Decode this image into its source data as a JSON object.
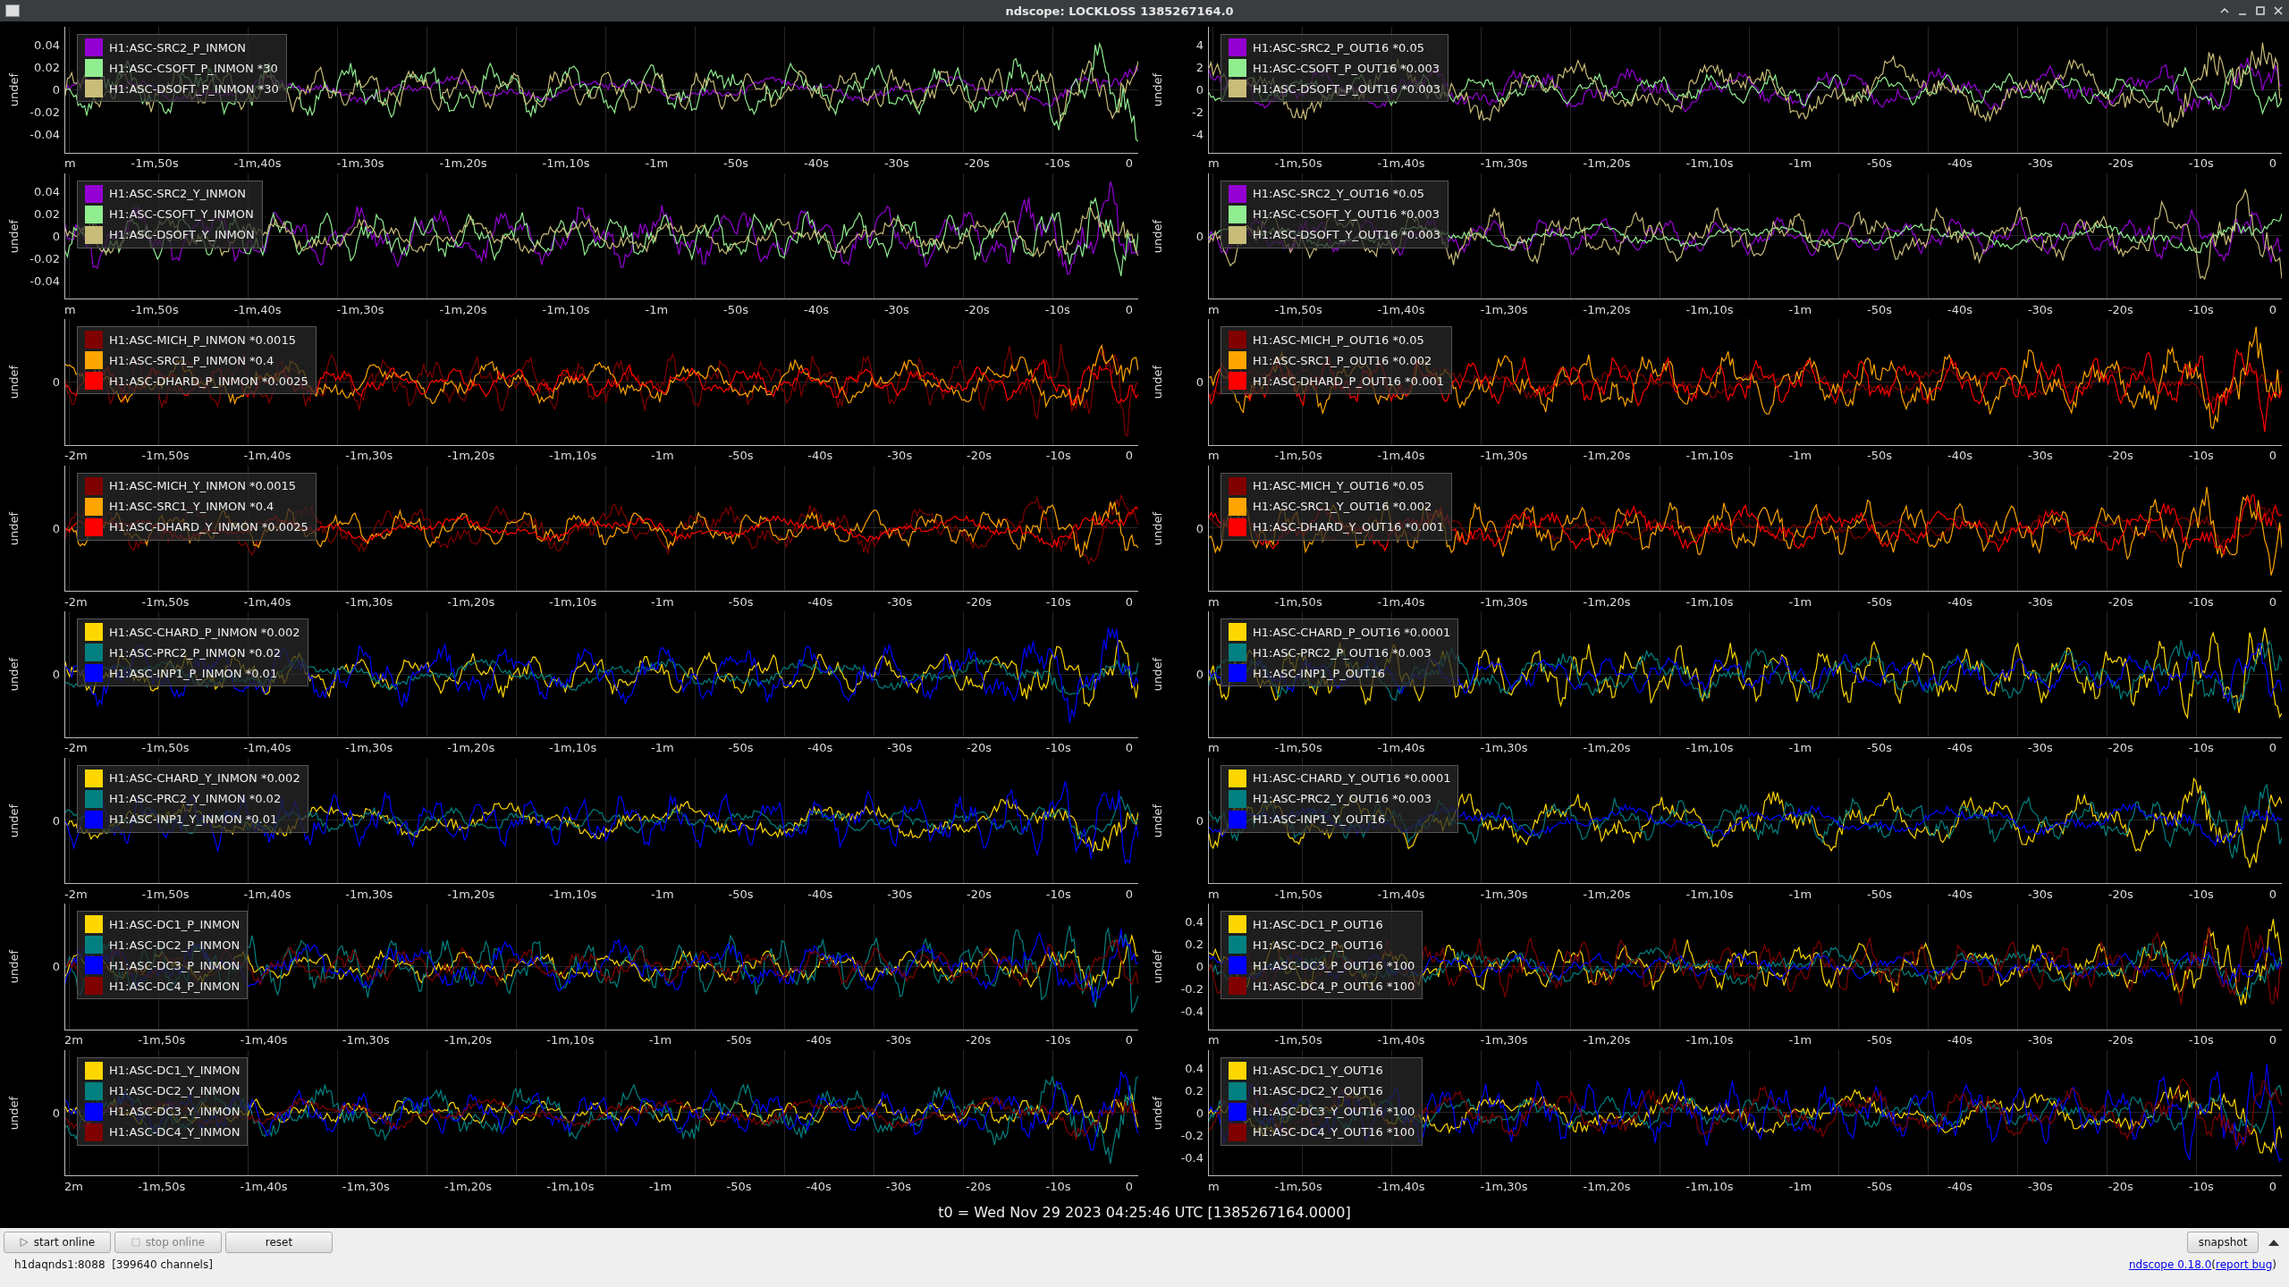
{
  "window": {
    "title": "ndscope: LOCKLOSS 1385267164.0"
  },
  "plots": [
    {
      "ylabel": "undef",
      "yticks": [
        "0.04",
        "0.02",
        "0",
        "-0.02",
        "-0.04"
      ],
      "xticks": [
        "m",
        "-1m,50s",
        "-1m,40s",
        "-1m,30s",
        "-1m,20s",
        "-1m,10s",
        "-1m",
        "-50s",
        "-40s",
        "-30s",
        "-20s",
        "-10s",
        "0"
      ],
      "channels": [
        {
          "name": "H1:ASC-SRC2_P_INMON",
          "color": "#9400d3"
        },
        {
          "name": "H1:ASC-CSOFT_P_INMON *30",
          "color": "#90ee90"
        },
        {
          "name": "H1:ASC-DSOFT_P_INMON *30",
          "color": "#c8bc78"
        }
      ]
    },
    {
      "ylabel": "undef",
      "yticks": [
        "4",
        "2",
        "0",
        "-2",
        "-4"
      ],
      "xticks": [
        "m",
        "-1m,50s",
        "-1m,40s",
        "-1m,30s",
        "-1m,20s",
        "-1m,10s",
        "-1m",
        "-50s",
        "-40s",
        "-30s",
        "-20s",
        "-10s",
        "0"
      ],
      "channels": [
        {
          "name": "H1:ASC-SRC2_P_OUT16 *0.05",
          "color": "#9400d3"
        },
        {
          "name": "H1:ASC-CSOFT_P_OUT16 *0.003",
          "color": "#90ee90"
        },
        {
          "name": "H1:ASC-DSOFT_P_OUT16 *0.003",
          "color": "#c8bc78"
        }
      ]
    },
    {
      "ylabel": "undef",
      "yticks": [
        "0.04",
        "0.02",
        "0",
        "-0.02",
        "-0.04"
      ],
      "xticks": [
        "m",
        "-1m,50s",
        "-1m,40s",
        "-1m,30s",
        "-1m,20s",
        "-1m,10s",
        "-1m",
        "-50s",
        "-40s",
        "-30s",
        "-20s",
        "-10s",
        "0"
      ],
      "channels": [
        {
          "name": "H1:ASC-SRC2_Y_INMON",
          "color": "#9400d3"
        },
        {
          "name": "H1:ASC-CSOFT_Y_INMON",
          "color": "#90ee90"
        },
        {
          "name": "H1:ASC-DSOFT_Y_INMON",
          "color": "#c8bc78"
        }
      ]
    },
    {
      "ylabel": "undef",
      "yticks": [
        "0"
      ],
      "xticks": [
        "m",
        "-1m,50s",
        "-1m,40s",
        "-1m,30s",
        "-1m,20s",
        "-1m,10s",
        "-1m",
        "-50s",
        "-40s",
        "-30s",
        "-20s",
        "-10s",
        "0"
      ],
      "channels": [
        {
          "name": "H1:ASC-SRC2_Y_OUT16 *0.05",
          "color": "#9400d3"
        },
        {
          "name": "H1:ASC-CSOFT_Y_OUT16 *0.003",
          "color": "#90ee90"
        },
        {
          "name": "H1:ASC-DSOFT_Y_OUT16 *0.003",
          "color": "#c8bc78"
        }
      ]
    },
    {
      "ylabel": "undef",
      "yticks": [
        "0"
      ],
      "xticks": [
        "-2m",
        "-1m,50s",
        "-1m,40s",
        "-1m,30s",
        "-1m,20s",
        "-1m,10s",
        "-1m",
        "-50s",
        "-40s",
        "-30s",
        "-20s",
        "-10s",
        "0"
      ],
      "channels": [
        {
          "name": "H1:ASC-MICH_P_INMON *0.0015",
          "color": "#800000"
        },
        {
          "name": "H1:ASC-SRC1_P_INMON *0.4",
          "color": "#ffa500"
        },
        {
          "name": "H1:ASC-DHARD_P_INMON *0.0025",
          "color": "#ff0000"
        }
      ]
    },
    {
      "ylabel": "undef",
      "yticks": [
        "0"
      ],
      "xticks": [
        "m",
        "-1m,50s",
        "-1m,40s",
        "-1m,30s",
        "-1m,20s",
        "-1m,10s",
        "-1m",
        "-50s",
        "-40s",
        "-30s",
        "-20s",
        "-10s",
        "0"
      ],
      "channels": [
        {
          "name": "H1:ASC-MICH_P_OUT16 *0.05",
          "color": "#800000"
        },
        {
          "name": "H1:ASC-SRC1_P_OUT16 *0.002",
          "color": "#ffa500"
        },
        {
          "name": "H1:ASC-DHARD_P_OUT16 *0.001",
          "color": "#ff0000"
        }
      ]
    },
    {
      "ylabel": "undef",
      "yticks": [
        "0"
      ],
      "xticks": [
        "-2m",
        "-1m,50s",
        "-1m,40s",
        "-1m,30s",
        "-1m,20s",
        "-1m,10s",
        "-1m",
        "-50s",
        "-40s",
        "-30s",
        "-20s",
        "-10s",
        "0"
      ],
      "channels": [
        {
          "name": "H1:ASC-MICH_Y_INMON *0.0015",
          "color": "#800000"
        },
        {
          "name": "H1:ASC-SRC1_Y_INMON *0.4",
          "color": "#ffa500"
        },
        {
          "name": "H1:ASC-DHARD_Y_INMON *0.0025",
          "color": "#ff0000"
        }
      ]
    },
    {
      "ylabel": "undef",
      "yticks": [
        "0"
      ],
      "xticks": [
        "m",
        "-1m,50s",
        "-1m,40s",
        "-1m,30s",
        "-1m,20s",
        "-1m,10s",
        "-1m",
        "-50s",
        "-40s",
        "-30s",
        "-20s",
        "-10s",
        "0"
      ],
      "channels": [
        {
          "name": "H1:ASC-MICH_Y_OUT16 *0.05",
          "color": "#800000"
        },
        {
          "name": "H1:ASC-SRC1_Y_OUT16 *0.002",
          "color": "#ffa500"
        },
        {
          "name": "H1:ASC-DHARD_Y_OUT16 *0.001",
          "color": "#ff0000"
        }
      ]
    },
    {
      "ylabel": "undef",
      "yticks": [
        "0"
      ],
      "xticks": [
        "-2m",
        "-1m,50s",
        "-1m,40s",
        "-1m,30s",
        "-1m,20s",
        "-1m,10s",
        "-1m",
        "-50s",
        "-40s",
        "-30s",
        "-20s",
        "-10s",
        "0"
      ],
      "channels": [
        {
          "name": "H1:ASC-CHARD_P_INMON *0.002",
          "color": "#ffd700"
        },
        {
          "name": "H1:ASC-PRC2_P_INMON *0.02",
          "color": "#008080"
        },
        {
          "name": "H1:ASC-INP1_P_INMON *0.01",
          "color": "#0000ff"
        }
      ]
    },
    {
      "ylabel": "undef",
      "yticks": [
        "0"
      ],
      "xticks": [
        "m",
        "-1m,50s",
        "-1m,40s",
        "-1m,30s",
        "-1m,20s",
        "-1m,10s",
        "-1m",
        "-50s",
        "-40s",
        "-30s",
        "-20s",
        "-10s",
        "0"
      ],
      "channels": [
        {
          "name": "H1:ASC-CHARD_P_OUT16 *0.0001",
          "color": "#ffd700"
        },
        {
          "name": "H1:ASC-PRC2_P_OUT16 *0.003",
          "color": "#008080"
        },
        {
          "name": "H1:ASC-INP1_P_OUT16",
          "color": "#0000ff"
        }
      ]
    },
    {
      "ylabel": "undef",
      "yticks": [
        "0"
      ],
      "xticks": [
        "-2m",
        "-1m,50s",
        "-1m,40s",
        "-1m,30s",
        "-1m,20s",
        "-1m,10s",
        "-1m",
        "-50s",
        "-40s",
        "-30s",
        "-20s",
        "-10s",
        "0"
      ],
      "channels": [
        {
          "name": "H1:ASC-CHARD_Y_INMON *0.002",
          "color": "#ffd700"
        },
        {
          "name": "H1:ASC-PRC2_Y_INMON *0.02",
          "color": "#008080"
        },
        {
          "name": "H1:ASC-INP1_Y_INMON *0.01",
          "color": "#0000ff"
        }
      ]
    },
    {
      "ylabel": "undef",
      "yticks": [
        "0"
      ],
      "xticks": [
        "m",
        "-1m,50s",
        "-1m,40s",
        "-1m,30s",
        "-1m,20s",
        "-1m,10s",
        "-1m",
        "-50s",
        "-40s",
        "-30s",
        "-20s",
        "-10s",
        "0"
      ],
      "channels": [
        {
          "name": "H1:ASC-CHARD_Y_OUT16 *0.0001",
          "color": "#ffd700"
        },
        {
          "name": "H1:ASC-PRC2_Y_OUT16 *0.003",
          "color": "#008080"
        },
        {
          "name": "H1:ASC-INP1_Y_OUT16",
          "color": "#0000ff"
        }
      ]
    },
    {
      "ylabel": "undef",
      "yticks": [
        "0"
      ],
      "xticks": [
        "2m",
        "-1m,50s",
        "-1m,40s",
        "-1m,30s",
        "-1m,20s",
        "-1m,10s",
        "-1m",
        "-50s",
        "-40s",
        "-30s",
        "-20s",
        "-10s",
        "0"
      ],
      "channels": [
        {
          "name": "H1:ASC-DC1_P_INMON",
          "color": "#ffd700"
        },
        {
          "name": "H1:ASC-DC2_P_INMON",
          "color": "#008080"
        },
        {
          "name": "H1:ASC-DC3_P_INMON",
          "color": "#0000ff"
        },
        {
          "name": "H1:ASC-DC4_P_INMON",
          "color": "#800000"
        }
      ]
    },
    {
      "ylabel": "undef",
      "yticks": [
        "0.4",
        "0.2",
        "0",
        "-0.2",
        "-0.4"
      ],
      "xticks": [
        "m",
        "-1m,50s",
        "-1m,40s",
        "-1m,30s",
        "-1m,20s",
        "-1m,10s",
        "-1m",
        "-50s",
        "-40s",
        "-30s",
        "-20s",
        "-10s",
        "0"
      ],
      "channels": [
        {
          "name": "H1:ASC-DC1_P_OUT16",
          "color": "#ffd700"
        },
        {
          "name": "H1:ASC-DC2_P_OUT16",
          "color": "#008080"
        },
        {
          "name": "H1:ASC-DC3_P_OUT16 *100",
          "color": "#0000ff"
        },
        {
          "name": "H1:ASC-DC4_P_OUT16 *100",
          "color": "#800000"
        }
      ]
    },
    {
      "ylabel": "undef",
      "yticks": [
        "0"
      ],
      "xticks": [
        "2m",
        "-1m,50s",
        "-1m,40s",
        "-1m,30s",
        "-1m,20s",
        "-1m,10s",
        "-1m",
        "-50s",
        "-40s",
        "-30s",
        "-20s",
        "-10s",
        "0"
      ],
      "channels": [
        {
          "name": "H1:ASC-DC1_Y_INMON",
          "color": "#ffd700"
        },
        {
          "name": "H1:ASC-DC2_Y_INMON",
          "color": "#008080"
        },
        {
          "name": "H1:ASC-DC3_Y_INMON",
          "color": "#0000ff"
        },
        {
          "name": "H1:ASC-DC4_Y_INMON",
          "color": "#800000"
        }
      ]
    },
    {
      "ylabel": "undef",
      "yticks": [
        "0.4",
        "0.2",
        "0",
        "-0.2",
        "-0.4"
      ],
      "xticks": [
        "m",
        "-1m,50s",
        "-1m,40s",
        "-1m,30s",
        "-1m,20s",
        "-1m,10s",
        "-1m",
        "-50s",
        "-40s",
        "-30s",
        "-20s",
        "-10s",
        "0"
      ],
      "channels": [
        {
          "name": "H1:ASC-DC1_Y_OUT16",
          "color": "#ffd700"
        },
        {
          "name": "H1:ASC-DC2_Y_OUT16",
          "color": "#008080"
        },
        {
          "name": "H1:ASC-DC3_Y_OUT16 *100",
          "color": "#0000ff"
        },
        {
          "name": "H1:ASC-DC4_Y_OUT16 *100",
          "color": "#800000"
        }
      ]
    }
  ],
  "time_label": "t0 = Wed Nov 29 2023 04:25:46 UTC [1385267164.0000]",
  "toolbar": {
    "buttons": [
      {
        "label": "start online",
        "kind": "play",
        "disabled": false
      },
      {
        "label": "stop online",
        "kind": "stop",
        "disabled": true
      },
      {
        "label": "reset",
        "kind": "plain",
        "disabled": false
      }
    ],
    "snapshot": "snapshot"
  },
  "status": {
    "server": "h1daqnds1:8088  [399640 channels]",
    "version_link": "ndscope 0.18.0",
    "open_paren": "(",
    "report_link": "report bug",
    "close_paren": ")"
  }
}
